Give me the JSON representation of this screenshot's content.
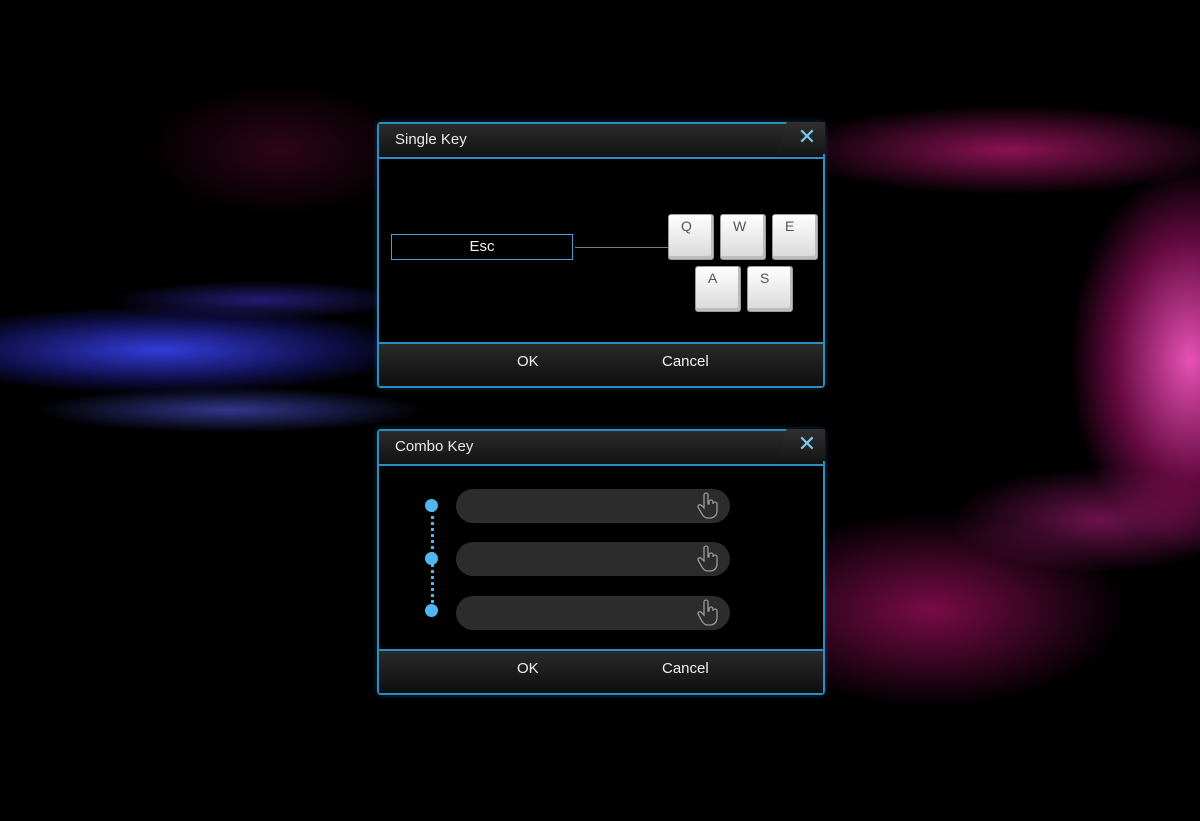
{
  "single_key_dialog": {
    "title": "Single Key",
    "close_glyph": "✕",
    "key_field_value": "Esc",
    "keys": [
      "Q",
      "W",
      "E",
      "A",
      "S"
    ],
    "ok_label": "OK",
    "cancel_label": "Cancel"
  },
  "combo_key_dialog": {
    "title": "Combo Key",
    "close_glyph": "✕",
    "slots": [
      "",
      "",
      ""
    ],
    "slot_icon": "hand-pointer-icon",
    "ok_label": "OK",
    "cancel_label": "Cancel"
  },
  "colors": {
    "accent": "#2a8fc0",
    "icon_blue": "#7cc8ee",
    "chain_blue": "#4fb6ee",
    "background_blue_smoke": "#3c46ff",
    "background_pink_smoke": "#e61e8c"
  }
}
